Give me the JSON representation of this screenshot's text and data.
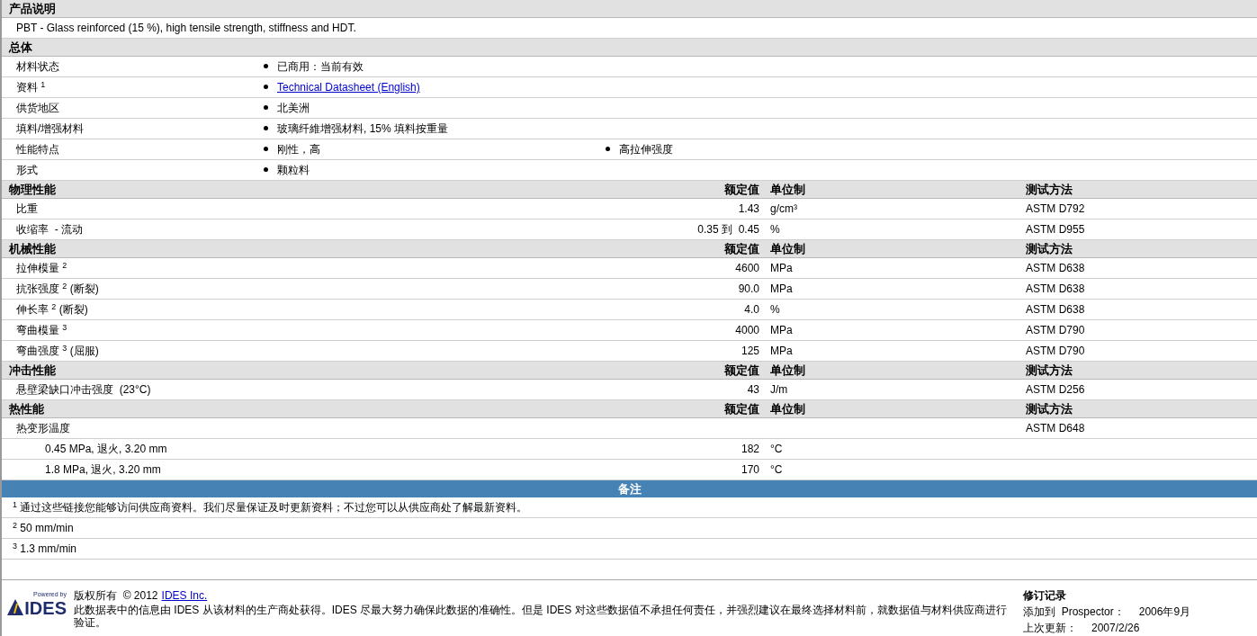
{
  "description": {
    "title": "产品说明",
    "text": "PBT - Glass reinforced (15 %), high tensile strength, stiffness and HDT."
  },
  "general": {
    "title": "总体",
    "rows": [
      {
        "label": "材料状态",
        "values": [
          {
            "kind": "text",
            "text": "已商用：当前有效"
          }
        ]
      },
      {
        "label": "资料 $^{1}$",
        "values": [
          {
            "kind": "link",
            "text": "Technical Datasheet (English)"
          }
        ]
      },
      {
        "label": "供货地区",
        "values": [
          {
            "kind": "text",
            "text": "北美洲"
          }
        ]
      },
      {
        "label": "填料/增强材料",
        "values": [
          {
            "kind": "text",
            "text": "玻璃纤維增强材料, 15% 填料按重量"
          }
        ]
      },
      {
        "label": "性能特点",
        "values": [
          {
            "kind": "text",
            "text": "刚性，高"
          },
          {
            "kind": "text",
            "text": "高拉伸强度"
          }
        ]
      },
      {
        "label": "形式",
        "values": [
          {
            "kind": "text",
            "text": "颗粒料"
          }
        ]
      }
    ]
  },
  "property_sections": [
    {
      "title": "物理性能",
      "value_heading": "额定值",
      "unit_heading": "单位制",
      "method_heading": "测试方法",
      "rows": [
        {
          "name": "比重",
          "value": "1.43",
          "unit": "g/cm³",
          "method": "ASTM D792"
        },
        {
          "name": "收缩率  - 流动",
          "value": "0.35 到  0.45",
          "unit": "%",
          "method": "ASTM D955"
        }
      ]
    },
    {
      "title": "机械性能",
      "value_heading": "额定值",
      "unit_heading": "单位制",
      "method_heading": "测试方法",
      "rows": [
        {
          "name": "拉伸模量 $^{2}$",
          "value": "4600",
          "unit": "MPa",
          "method": "ASTM D638"
        },
        {
          "name": "抗张强度 $^{2}$ (断裂)",
          "value": "90.0",
          "unit": "MPa",
          "method": "ASTM D638"
        },
        {
          "name": "伸长率 $^{2}$ (断裂)",
          "value": "4.0",
          "unit": "%",
          "method": "ASTM D638"
        },
        {
          "name": "弯曲模量 $^{3}$",
          "value": "4000",
          "unit": "MPa",
          "method": "ASTM D790"
        },
        {
          "name": "弯曲强度 $^{3}$ (屈服)",
          "value": "125",
          "unit": "MPa",
          "method": "ASTM D790"
        }
      ]
    },
    {
      "title": "冲击性能",
      "value_heading": "额定值",
      "unit_heading": "单位制",
      "method_heading": "测试方法",
      "rows": [
        {
          "name": "悬壁梁缺口冲击强度  (23°C)",
          "value": "43",
          "unit": "J/m",
          "method": "ASTM D256"
        }
      ]
    },
    {
      "title": "热性能",
      "value_heading": "额定值",
      "unit_heading": "单位制",
      "method_heading": "测试方法",
      "rows": [
        {
          "name": "热变形温度",
          "method": "ASTM D648",
          "children": [
            {
              "name": "0.45 MPa, 退火, 3.20 mm",
              "value": "182",
              "unit": "°C"
            },
            {
              "name": "1.8 MPa, 退火, 3.20 mm",
              "value": "170",
              "unit": "°C"
            }
          ]
        }
      ]
    }
  ],
  "notes": {
    "title": "备注",
    "items": [
      {
        "mark": "1",
        "text": "通过这些链接您能够访问供应商资料。我们尽量保证及时更新资料；不过您可以从供应商处了解最新资料。"
      },
      {
        "mark": "2",
        "text": "50 mm/min"
      },
      {
        "mark": "3",
        "text": "1.3 mm/min"
      }
    ]
  },
  "footer": {
    "logo_caption": "Powered by",
    "logo_text": "IDES",
    "copyright": "版权所有  © 2012",
    "copyright_link": "IDES Inc.",
    "disclaimer": "此数据表中的信息由  IDES 从该材料的生产商处获得。IDES 尽最大努力确保此数据的准确性。但是  IDES 对这些数据值不承担任何责任，并强烈建议在最终选择材料前，就数据值与材料供应商进行验证。",
    "revision": {
      "title": "修订记录",
      "rows": [
        {
          "label": "添加到  Prospector：",
          "value": "2006年9月"
        },
        {
          "label": "上次更新：",
          "value": "2007/2/26"
        }
      ]
    }
  }
}
